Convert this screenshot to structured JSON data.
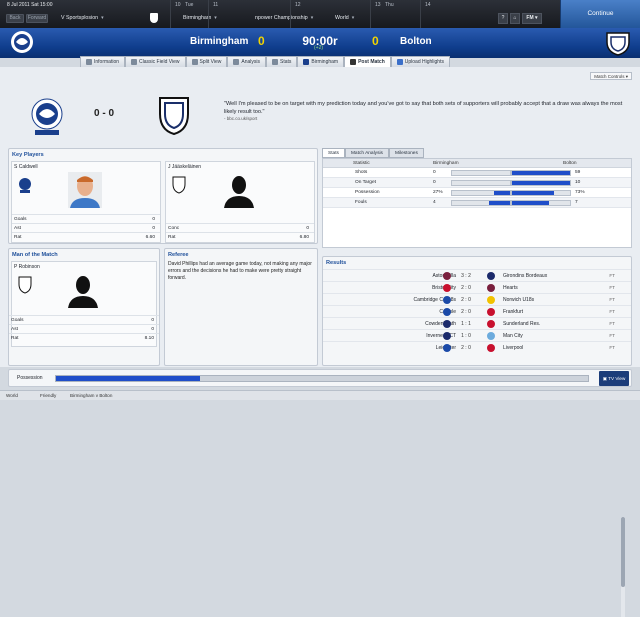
{
  "topbar": {
    "date": "8 Jul 2011 Sat  15:00",
    "back_label": "Back",
    "forward_label": "Forward",
    "nav1": "V Sportsplosion",
    "nav2": "Birmingham",
    "nav3": "npower Championship",
    "nav4": "World",
    "calendar": [
      "10",
      "Tue",
      "11",
      "12",
      "13",
      "Thu",
      "14"
    ],
    "fm_label": "FM",
    "continue_label": "Continue"
  },
  "header": {
    "home_team": "Birmingham",
    "away_team": "Bolton",
    "home_score": "0",
    "away_score": "0",
    "clock": "90:00r",
    "added": "(+2)"
  },
  "tabs": [
    "Information",
    "Classic Field View",
    "Split View",
    "Analysis",
    "Stats",
    "Birmingham",
    "Post Match",
    "Upload Highlights"
  ],
  "active_tab": "Post Match",
  "match_controls": "Match Controls",
  "summary": {
    "score": "0 - 0",
    "quote": "\"Well I'm pleased to be on target with my prediction today and you've got to say that both sets of supporters will probably accept that a draw was always the most likely result too.\"",
    "source": "- bbc.co.uk/sport"
  },
  "key_players": {
    "title": "Key Players",
    "home": {
      "name": "S Caldwell",
      "stats": [
        [
          "Goals",
          "0"
        ],
        [
          "Ast",
          "0"
        ],
        [
          "Rat",
          "6.60"
        ]
      ]
    },
    "away": {
      "name": "J Jääskeläinen",
      "stats": [
        [
          "Conc",
          "0"
        ],
        [
          "Rat",
          "6.80"
        ]
      ]
    }
  },
  "motm": {
    "title": "Man of the Match",
    "name": "P Robinson",
    "stats": [
      [
        "Goals",
        "0"
      ],
      [
        "Ast",
        "0"
      ],
      [
        "Rat",
        "8.10"
      ]
    ]
  },
  "referee": {
    "title": "Referee",
    "text": "David Phillips had an average game today, not making any major errors and the decisions he had to make were pretty straight forward."
  },
  "stats_tabs": [
    "Stats",
    "Match Analysis",
    "Milestones"
  ],
  "stats": {
    "headers": [
      "Statistic",
      "Birmingham",
      "Bolton"
    ],
    "rows": [
      {
        "label": "Shots",
        "home": "0",
        "away": "59",
        "home_pct": 0,
        "away_pct": 1
      },
      {
        "label": "On Target",
        "home": "0",
        "away": "10",
        "home_pct": 0,
        "away_pct": 1
      },
      {
        "label": "Possession",
        "home": "27%",
        "away": "73%",
        "home_pct": 0.27,
        "away_pct": 0.73
      },
      {
        "label": "Fouls",
        "home": "4",
        "away": "7",
        "home_pct": 0.36,
        "away_pct": 0.64
      }
    ]
  },
  "results": {
    "title": "Results",
    "rows": [
      {
        "home": "Aston Villa",
        "score": "3 : 2",
        "away": "Girondins Bordeaux",
        "status": "FT",
        "hc": "#7a1f3d",
        "ac": "#1b2a6b"
      },
      {
        "home": "Bristol City",
        "score": "2 : 0",
        "away": "Hearts",
        "status": "FT",
        "hc": "#c8102e",
        "ac": "#7a1f3d"
      },
      {
        "home": "Cambridge C U18s",
        "score": "2 : 0",
        "away": "Norwich U18s",
        "status": "FT",
        "hc": "#1b4aa8",
        "ac": "#f2c200"
      },
      {
        "home": "Carlisle",
        "score": "2 : 0",
        "away": "Frankfurt",
        "status": "FT",
        "hc": "#1b4aa8",
        "ac": "#c8102e"
      },
      {
        "home": "Cowdenbeath",
        "score": "1 : 1",
        "away": "Sunderland Res.",
        "status": "FT",
        "hc": "#1b2a6b",
        "ac": "#c8102e"
      },
      {
        "home": "Inverness CT",
        "score": "1 : 0",
        "away": "Man City",
        "status": "FT",
        "hc": "#1b2a6b",
        "ac": "#6cabdd"
      },
      {
        "home": "Leicester",
        "score": "2 : 0",
        "away": "Liverpool",
        "status": "FT",
        "hc": "#1b4aa8",
        "ac": "#c8102e"
      }
    ]
  },
  "possession": {
    "label": "Possession",
    "home_pct": 0.27
  },
  "tv_view": "TV View",
  "statusbar": {
    "items": [
      "World",
      "Friendly",
      "Birmingham v Bolton"
    ]
  }
}
